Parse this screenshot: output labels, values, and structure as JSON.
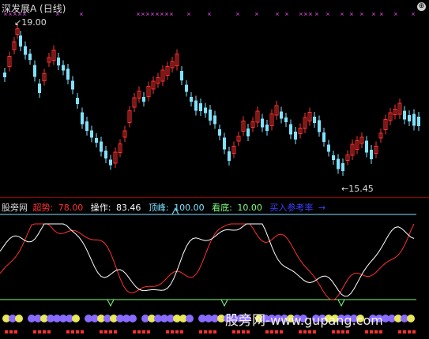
{
  "header": {
    "title": "深发展A (日线)",
    "corner_button": "⊕"
  },
  "main_chart": {
    "high_label": "19.00",
    "low_label": "15.45",
    "up_color": "#ff3030",
    "down_color": "#7fe3ff",
    "signal_color": "#ff55ff",
    "signal_glyph": "×"
  },
  "indicator": {
    "name": "股旁网",
    "trend_label": "超势:",
    "trend_value": "78.00",
    "op_label": "操作:",
    "op_value": "83.46",
    "peak_label": "顶峰:",
    "peak_value": "100.00",
    "bottom_label": "看底:",
    "bottom_value": "10.00",
    "buy_label": "买入参考率",
    "buy_arrow": "→",
    "peak_line_color": "#7ee1ff",
    "bottom_line_color": "#7dff7d",
    "trend_color": "#ff3030",
    "op_color": "#ffffff"
  },
  "watermark": {
    "text": "股旁网",
    "url": "www.gupang.com"
  }
}
